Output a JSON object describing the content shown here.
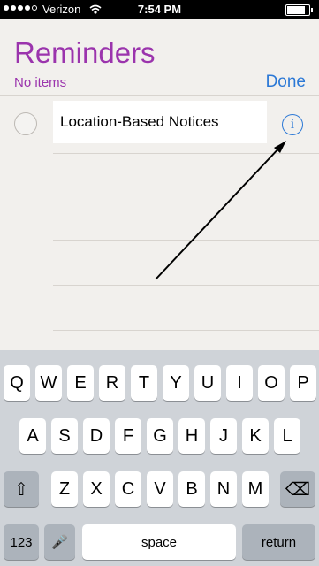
{
  "status": {
    "carrier": "Verizon",
    "time": "7:54 PM",
    "signal_bars": 4
  },
  "app": {
    "title": "Reminders",
    "subtitle": "No items",
    "done_label": "Done",
    "notice_label": "Location-Based Notices",
    "info_glyph": "i"
  },
  "colors": {
    "accent_purple": "#9b34ad",
    "accent_blue": "#2b78d6"
  },
  "keyboard": {
    "row1": [
      "Q",
      "W",
      "E",
      "R",
      "T",
      "Y",
      "U",
      "I",
      "O",
      "P"
    ],
    "row2": [
      "A",
      "S",
      "D",
      "F",
      "G",
      "H",
      "J",
      "K",
      "L"
    ],
    "row3": [
      "Z",
      "X",
      "C",
      "V",
      "B",
      "N",
      "M"
    ],
    "shift": "⇧",
    "backspace": "⌫",
    "numbers": "123",
    "mic": "🎤",
    "space": "space",
    "return": "return"
  }
}
